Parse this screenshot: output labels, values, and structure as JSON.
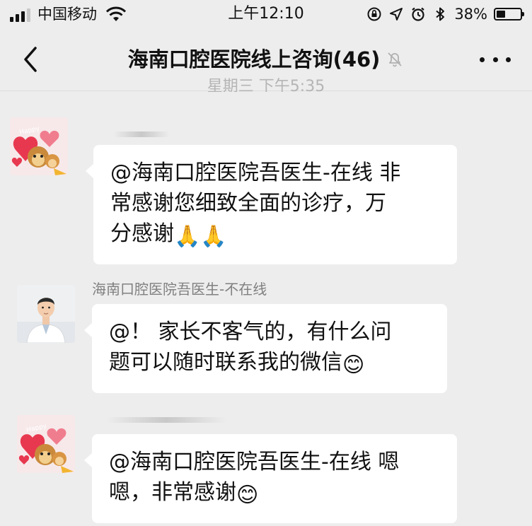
{
  "status_bar": {
    "carrier": "中国移动",
    "time": "上午12:10",
    "battery_percent": "38%",
    "battery_level": 0.38
  },
  "nav": {
    "title": "海南口腔医院线上咨询(46)"
  },
  "timestamp": "星期三 下午5:35",
  "messages": [
    {
      "lines": [
        "@海南口腔医院吾医生-在线 非",
        "常感谢您细致全面的诊疗，万",
        "分感谢"
      ],
      "emoji": [
        "🙏",
        "🙏"
      ]
    },
    {
      "sender": "海南口腔医院吾医生-不在线",
      "lines": [
        "@！ 家长不客气的，有什么问",
        "题可以随时联系我的微信"
      ],
      "emoji": [
        "😊"
      ]
    },
    {
      "lines": [
        "@海南口腔医院吾医生-在线 嗯",
        "嗯，非常感谢"
      ],
      "emoji": [
        "😊"
      ]
    }
  ]
}
